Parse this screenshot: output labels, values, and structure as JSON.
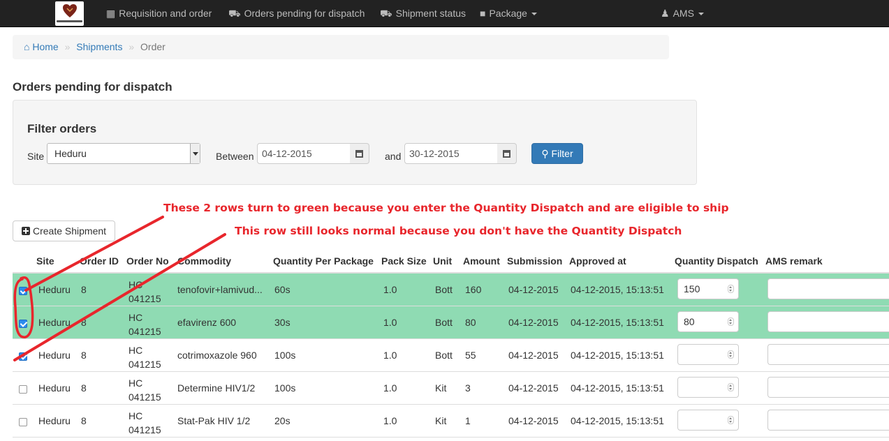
{
  "navbar": {
    "brand_icon": "department-of-health-logo",
    "items": [
      {
        "label": "Requisition and order",
        "icon": "table-icon"
      },
      {
        "label": "Orders pending for dispatch",
        "icon": "cart-icon"
      },
      {
        "label": "Shipment status",
        "icon": "truck-icon"
      },
      {
        "label": "Package",
        "icon": "gift-icon"
      }
    ],
    "user": {
      "label": "AMS",
      "icon": "user-icon"
    }
  },
  "breadcrumb": {
    "home": "Home",
    "shipments": "Shipments",
    "current": "Order",
    "separator": "»"
  },
  "page_title": "Orders pending for dispatch",
  "filter": {
    "title": "Filter orders",
    "site_label": "Site",
    "site_value": "Heduru",
    "between_label": "Between",
    "start_date": "04-12-2015",
    "and_label": "and",
    "end_date": "30-12-2015",
    "button_label": "Filter"
  },
  "annotations": {
    "note1": "These 2 rows turn to green because you enter the Quantity Dispatch and are eligible to ship",
    "note2": "This row still looks normal because you don't have the Quantity Dispatch",
    "color": "#e8262c"
  },
  "create_shipment_label": "Create Shipment",
  "table": {
    "headers": {
      "site": "Site",
      "order_id": "Order ID",
      "order_no": "Order No",
      "commodity": "Commodity",
      "qty_per_package": "Quantity Per Package",
      "pack_size": "Pack Size",
      "unit": "Unit",
      "amount": "Amount",
      "submission": "Submission",
      "approved_at": "Approved at",
      "qty_dispatch": "Quantity Dispatch",
      "ams_remark": "AMS remark"
    },
    "rows": [
      {
        "checked": true,
        "highlight": true,
        "site": "Heduru",
        "order_id": "8",
        "order_no_1": "HC",
        "order_no_2": "041215",
        "commodity": "tenofovir+lamivud...",
        "qty_per_package": "60s",
        "pack_size": "1.0",
        "unit": "Bott",
        "amount": "160",
        "submission": "04-12-2015",
        "approved_at": "04-12-2015, 15:13:51",
        "qty_dispatch": "150",
        "ams_remark": ""
      },
      {
        "checked": true,
        "highlight": true,
        "site": "Heduru",
        "order_id": "8",
        "order_no_1": "HC",
        "order_no_2": "041215",
        "commodity": "efavirenz 600",
        "qty_per_package": "30s",
        "pack_size": "1.0",
        "unit": "Bott",
        "amount": "80",
        "submission": "04-12-2015",
        "approved_at": "04-12-2015, 15:13:51",
        "qty_dispatch": "80",
        "ams_remark": ""
      },
      {
        "checked": true,
        "highlight": false,
        "site": "Heduru",
        "order_id": "8",
        "order_no_1": "HC",
        "order_no_2": "041215",
        "commodity": "cotrimoxazole 960",
        "qty_per_package": "100s",
        "pack_size": "1.0",
        "unit": "Bott",
        "amount": "55",
        "submission": "04-12-2015",
        "approved_at": "04-12-2015, 15:13:51",
        "qty_dispatch": "",
        "ams_remark": ""
      },
      {
        "checked": false,
        "highlight": false,
        "site": "Heduru",
        "order_id": "8",
        "order_no_1": "HC",
        "order_no_2": "041215",
        "commodity": "Determine HIV1/2",
        "qty_per_package": "100s",
        "pack_size": "1.0",
        "unit": "Kit",
        "amount": "3",
        "submission": "04-12-2015",
        "approved_at": "04-12-2015, 15:13:51",
        "qty_dispatch": "",
        "ams_remark": ""
      },
      {
        "checked": false,
        "highlight": false,
        "site": "Heduru",
        "order_id": "8",
        "order_no_1": "HC",
        "order_no_2": "041215",
        "commodity": "Stat-Pak HIV 1/2",
        "qty_per_package": "20s",
        "pack_size": "1.0",
        "unit": "Kit",
        "amount": "1",
        "submission": "04-12-2015",
        "approved_at": "04-12-2015, 15:13:51",
        "qty_dispatch": "",
        "ams_remark": ""
      }
    ],
    "highlight_color": "#8fdbb3"
  }
}
